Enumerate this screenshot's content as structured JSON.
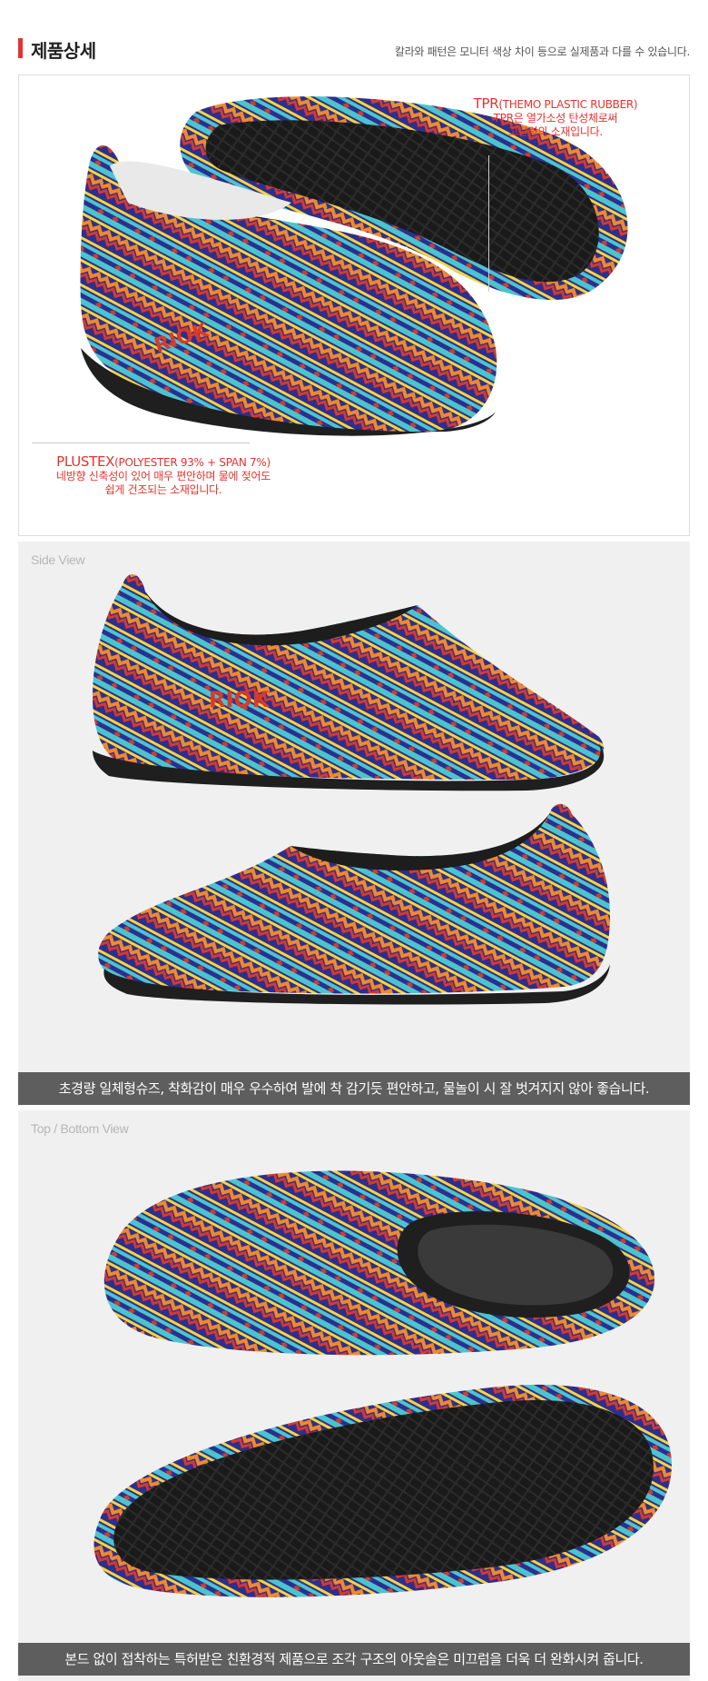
{
  "header": {
    "title": "제품상세",
    "note": "칼라와 패턴은 모니터 색상 차이 등으로 실제품과 다를 수 있습니다."
  },
  "detail": {
    "tpr_title": "TPR",
    "tpr_sub": "(THEMO PLASTIC RUBBER)",
    "tpr_line1": "TPR은 열가소성 탄성체로써",
    "tpr_line2": "고탄력의 소재입니다.",
    "plustex_title": "PLUSTEX",
    "plustex_sub": "(POLYESTER 93% + SPAN 7%)",
    "plustex_line1": "네방향 신축성이 있어 매우 편안하며 물에 젖어도",
    "plustex_line2": "쉽게 건조되는 소재입니다."
  },
  "side": {
    "label": "Side View",
    "caption": "초경량 일체형슈즈, 착화감이 매우 우수하여 발에 착 감기듯 편안하고, 물놀이 시 잘 벗겨지지 않아 좋습니다."
  },
  "top": {
    "label": "Top / Bottom View",
    "caption": "본드 없이 접착하는 특허받은 친환경적 제품으로 조각 구조의 아웃솔은 미끄럼을 더욱 더 완화시켜 줍니다."
  },
  "colors": {
    "accent": "#e3342f",
    "band": "#5e5e5e",
    "shoe_navy": "#2c2f8f",
    "shoe_orange": "#f2892a",
    "shoe_yellow": "#f5d53a",
    "shoe_teal": "#4cc4cc",
    "shoe_red": "#d93a2a",
    "sole": "#1f1f1f"
  }
}
